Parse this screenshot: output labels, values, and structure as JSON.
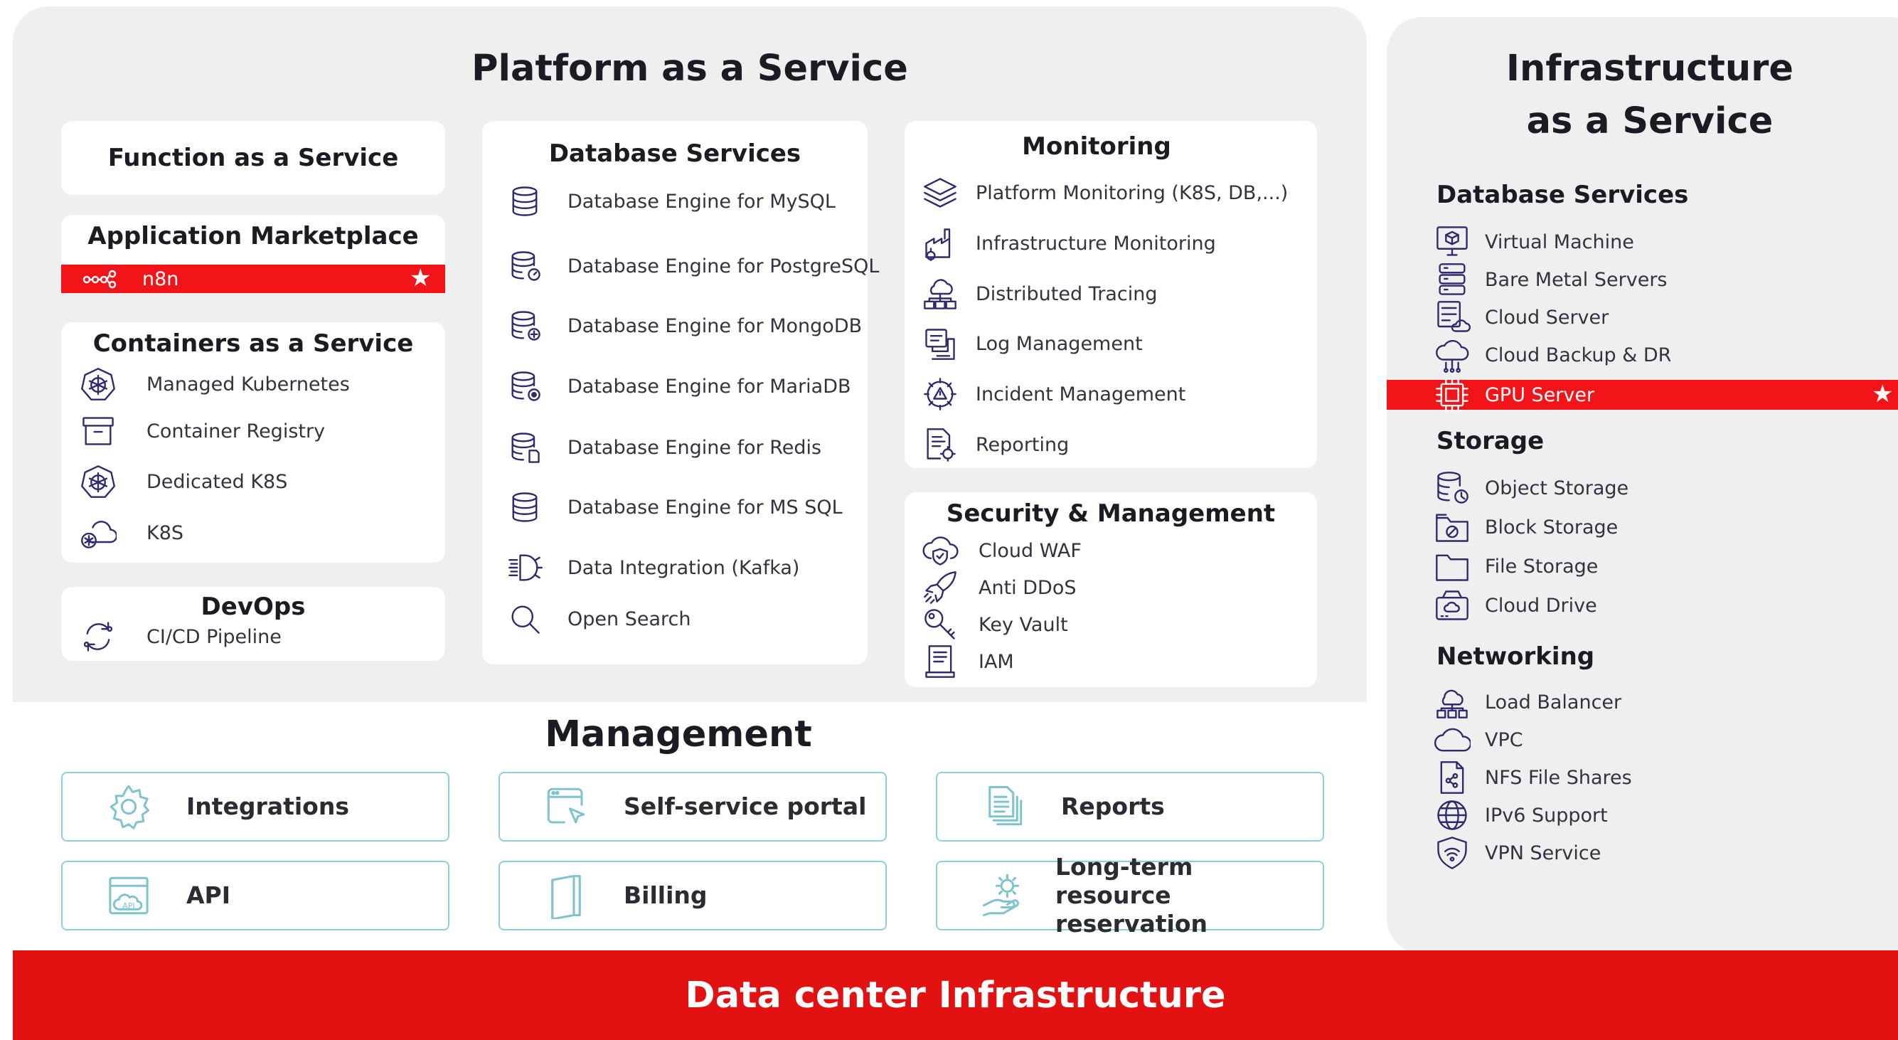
{
  "paas": {
    "title": "Platform as a Service",
    "faas": {
      "title": "Function as a Service"
    },
    "marketplace": {
      "title": "Application Marketplace",
      "items": [
        {
          "label": "n8n",
          "icon": "workflow-nodes-icon"
        }
      ]
    },
    "caas": {
      "title": "Containers as a Service",
      "items": [
        {
          "label": "Managed Kubernetes",
          "icon": "kubernetes-icon"
        },
        {
          "label": "Container Registry",
          "icon": "archive-box-icon"
        },
        {
          "label": "Dedicated K8S",
          "icon": "kubernetes-icon"
        },
        {
          "label": "K8S",
          "icon": "kubernetes-cloud-icon"
        }
      ]
    },
    "devops": {
      "title": "DevOps",
      "items": [
        {
          "label": "CI/CD Pipeline",
          "icon": "sync-arrows-icon"
        }
      ]
    },
    "database": {
      "title": "Database Services",
      "items": [
        {
          "label": "Database Engine for MySQL",
          "icon": "database-icon"
        },
        {
          "label": "Database Engine for PostgreSQL",
          "icon": "database-gauge-icon"
        },
        {
          "label": "Database Engine for MongoDB",
          "icon": "database-plus-icon"
        },
        {
          "label": "Database Engine for MariaDB",
          "icon": "database-dot-icon"
        },
        {
          "label": "Database Engine for Redis",
          "icon": "database-file-icon"
        },
        {
          "label": "Database Engine for MS SQL",
          "icon": "database-icon"
        },
        {
          "label": "Data Integration (Kafka)",
          "icon": "data-integration-icon"
        },
        {
          "label": "Open Search",
          "icon": "search-icon"
        }
      ]
    },
    "monitoring": {
      "title": "Monitoring",
      "items": [
        {
          "label": "Platform Monitoring (K8S, DB,...)",
          "icon": "layers-icon"
        },
        {
          "label": "Infrastructure Monitoring",
          "icon": "factory-icon"
        },
        {
          "label": "Distributed Tracing",
          "icon": "network-tree-icon"
        },
        {
          "label": "Log Management",
          "icon": "log-monitor-icon"
        },
        {
          "label": "Incident Management",
          "icon": "incident-gear-icon"
        },
        {
          "label": "Reporting",
          "icon": "report-gear-icon"
        }
      ]
    },
    "security": {
      "title": "Security & Management",
      "items": [
        {
          "label": "Cloud WAF",
          "icon": "cloud-shield-icon"
        },
        {
          "label": "Anti DDoS",
          "icon": "rocket-icon"
        },
        {
          "label": "Key Vault",
          "icon": "key-icon"
        },
        {
          "label": "IAM",
          "icon": "document-icon"
        }
      ]
    }
  },
  "management": {
    "title": "Management",
    "items": [
      {
        "label": "Integrations",
        "icon": "gear-icon"
      },
      {
        "label": "Self-service portal",
        "icon": "browser-cursor-icon"
      },
      {
        "label": "Reports",
        "icon": "documents-icon"
      },
      {
        "label": "API",
        "icon": "api-window-icon"
      },
      {
        "label": "Billing",
        "icon": "book-icon"
      },
      {
        "label": "Long-term resource reservation",
        "icon": "hand-gear-icon"
      }
    ]
  },
  "iaas": {
    "title_line1": "Infrastructure",
    "title_line2": "as a Service",
    "database": {
      "title": "Database Services",
      "items": [
        {
          "label": "Virtual Machine",
          "icon": "monitor-cube-icon"
        },
        {
          "label": "Bare Metal Servers",
          "icon": "server-stack-icon"
        },
        {
          "label": "Cloud Server",
          "icon": "cloud-server-icon"
        },
        {
          "label": "Cloud Backup & DR",
          "icon": "cloud-backup-icon"
        },
        {
          "label": "GPU Server",
          "icon": "chip-icon"
        }
      ]
    },
    "storage": {
      "title": "Storage",
      "items": [
        {
          "label": "Object Storage",
          "icon": "object-storage-icon"
        },
        {
          "label": "Block Storage",
          "icon": "folder-block-icon"
        },
        {
          "label": "File Storage",
          "icon": "folder-icon"
        },
        {
          "label": "Cloud Drive",
          "icon": "drive-icon"
        }
      ]
    },
    "networking": {
      "title": "Networking",
      "items": [
        {
          "label": "Load Balancer",
          "icon": "load-balancer-icon"
        },
        {
          "label": "VPC",
          "icon": "cloud-icon"
        },
        {
          "label": "NFS File Shares",
          "icon": "file-share-icon"
        },
        {
          "label": "IPv6 Support",
          "icon": "globe-icon"
        },
        {
          "label": "VPN Service",
          "icon": "shield-wifi-icon"
        }
      ]
    }
  },
  "footer": {
    "label": "Data center Infrastructure"
  },
  "colors": {
    "accent_red": "#f21419",
    "footer_red": "#e31212",
    "panel_grey": "#efefef",
    "icon_navy": "#2d2b6e",
    "mgmt_border": "#8ecfd9"
  }
}
